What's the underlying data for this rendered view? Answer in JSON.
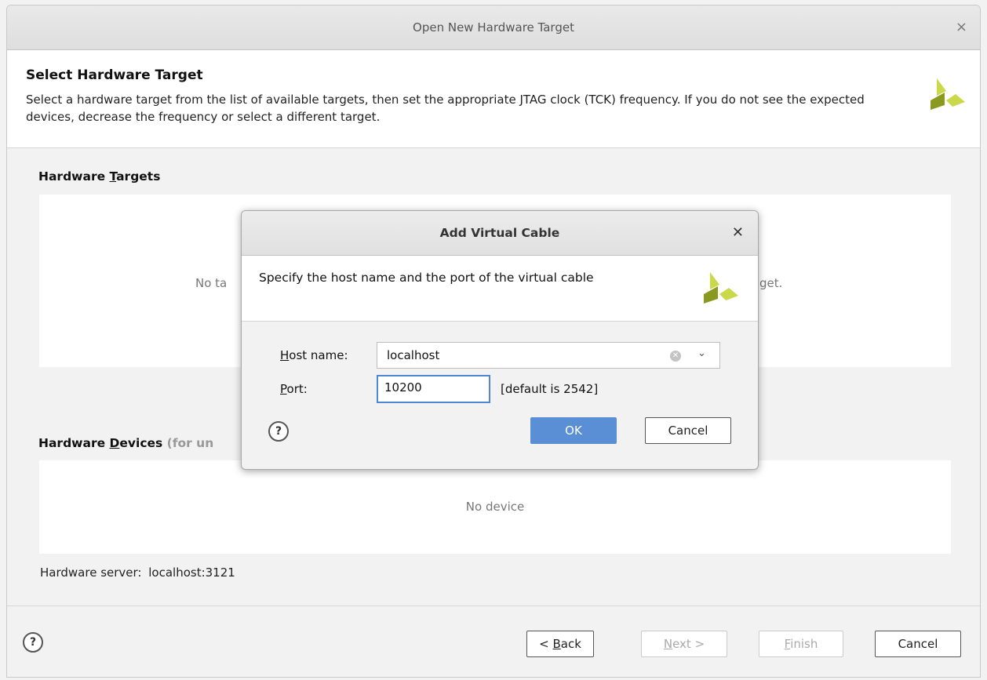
{
  "window": {
    "title": "Open New Hardware Target",
    "close_glyph": "×"
  },
  "header": {
    "title": "Select Hardware Target",
    "description": "Select a hardware target from the list of available targets, then set the appropriate JTAG clock (TCK) frequency. If you do not see the expected devices, decrease the frequency or select a different target.",
    "logo_icon": "xilinx-logo-icon"
  },
  "targets": {
    "label_pre": "Hardware ",
    "label_mnemonic": "T",
    "label_post": "argets",
    "empty_left": "No ta",
    "empty_right": "get."
  },
  "devices": {
    "label_pre": "Hardware ",
    "label_mnemonic": "D",
    "label_post": "evices",
    "label_suffix": " (for un",
    "empty_text": "No device"
  },
  "server": {
    "label": "Hardware server:",
    "value": "localhost:3121"
  },
  "footer": {
    "help_glyph": "?",
    "back": {
      "pre": "< ",
      "mnemonic": "B",
      "post": "ack"
    },
    "next": {
      "mnemonic": "N",
      "post": "ext >"
    },
    "finish": {
      "mnemonic": "F",
      "post": "inish"
    },
    "cancel": "Cancel"
  },
  "modal": {
    "title": "Add Virtual Cable",
    "close_glyph": "✕",
    "description": "Specify the host name and the port of the virtual cable",
    "host": {
      "label_mnemonic": "H",
      "label_post": "ost name:",
      "value": "localhost",
      "clear_glyph": "✕",
      "dropdown_glyph": "⌄"
    },
    "port": {
      "label_mnemonic": "P",
      "label_post": "ort:",
      "value": "10200",
      "hint": "[default is 2542]"
    },
    "help_glyph": "?",
    "ok": "OK",
    "cancel": "Cancel"
  },
  "colors": {
    "accent": "#5a8fd6",
    "logo_light": "#c9d94a",
    "logo_dark": "#8a9a1e"
  }
}
